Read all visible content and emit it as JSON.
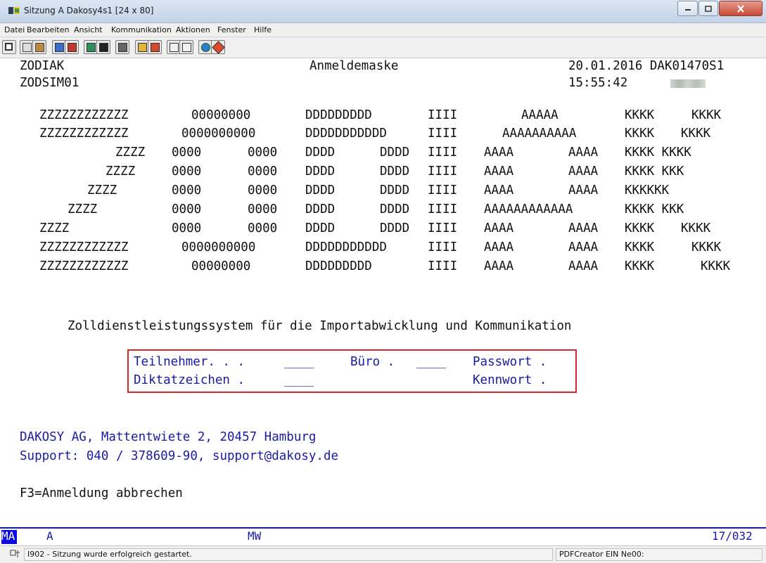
{
  "window": {
    "title": "Sitzung A Dakosy4s1 [24 x 80]",
    "minimize_icon": "minimize-icon",
    "maximize_icon": "maximize-icon",
    "close_icon": "close-icon"
  },
  "menu": {
    "items": [
      "Datei",
      "Bearbeiten",
      "Ansicht",
      "Kommunikation",
      "Aktionen",
      "Fenster",
      "Hilfe"
    ]
  },
  "toolbar": {
    "icons": [
      "display-icon",
      "copy-icon",
      "paste-icon",
      "send-icon",
      "receive-icon",
      "macro-record-icon",
      "macro-play-icon",
      "keyboard-icon",
      "transfer-upload-icon",
      "transfer-download-icon",
      "graph-up-icon",
      "graph-down-icon",
      "globe-icon",
      "help-icon"
    ]
  },
  "screen": {
    "system_name": "ZODIAK",
    "screen_title": "Anmeldemaske",
    "date_id": "20.01.2016 DAK01470S1",
    "program_id": "ZODSIM01",
    "time": "15:55:42",
    "logo_rows": [
      [
        "ZZZZZZZZZZZZ",
        "00000000",
        "DDDDDDDDD",
        "IIII",
        "AAAAA",
        "KKKK",
        "KKKK"
      ],
      [
        "ZZZZZZZZZZZZ",
        "0000000000",
        "DDDDDDDDDDD",
        "IIII",
        "AAAAAAAAAA",
        "KKKK",
        "KKKK"
      ],
      [
        "ZZZZ",
        "0000",
        "0000",
        "DDDD",
        "DDDD",
        "IIII",
        "AAAA",
        "AAAA",
        "KKKK KKKK"
      ],
      [
        "ZZZZ",
        "0000",
        "0000",
        "DDDD",
        "DDDD",
        "IIII",
        "AAAA",
        "AAAA",
        "KKKK KKK"
      ],
      [
        "ZZZZ",
        "0000",
        "0000",
        "DDDD",
        "DDDD",
        "IIII",
        "AAAA",
        "AAAA",
        "KKKKKK"
      ],
      [
        "ZZZZ",
        "0000",
        "0000",
        "DDDD",
        "DDDD",
        "IIII",
        "AAAAAAAAAAAA",
        "KKKK KKK"
      ],
      [
        "ZZZZ",
        "0000",
        "0000",
        "DDDD",
        "DDDD",
        "IIII",
        "AAAA",
        "AAAA",
        "KKKK",
        "KKKK"
      ],
      [
        "ZZZZZZZZZZZZ",
        "0000000000",
        "DDDDDDDDDDD",
        "IIII",
        "AAAA",
        "AAAA",
        "KKKK",
        "KKKK"
      ],
      [
        "ZZZZZZZZZZZZ",
        "00000000",
        "DDDDDDDDD",
        "IIII",
        "AAAA",
        "AAAA",
        "KKKK",
        "KKKK"
      ]
    ],
    "subtitle": "Zolldienstleistungssystem für die Importabwicklung und Kommunikation",
    "login": {
      "teilnehmer_label": "Teilnehmer. . .",
      "teilnehmer_value": "____",
      "buero_label": "Büro .",
      "buero_value": "____",
      "passwort_label": "Passwort .",
      "diktat_label": "Diktatzeichen .",
      "diktat_value": "____",
      "kennwort_label": "Kennwort ."
    },
    "address": "DAKOSY AG, Mattentwiete 2, 20457 Hamburg",
    "support": "Support: 040 / 378609-90, support@dakosy.de",
    "f3": "F3=Anmeldung abbrechen"
  },
  "oia": {
    "ma": "MA",
    "a": "A",
    "mw": "MW",
    "position": "17/032"
  },
  "statusbar": {
    "message": "I902 - Sitzung wurde erfolgreich gestartet.",
    "printer": "PDFCreator EIN Ne00:"
  },
  "colors": {
    "terminal_text": "#111111",
    "field_blue": "#1a1aa8",
    "highlight_red": "#e0242a"
  }
}
